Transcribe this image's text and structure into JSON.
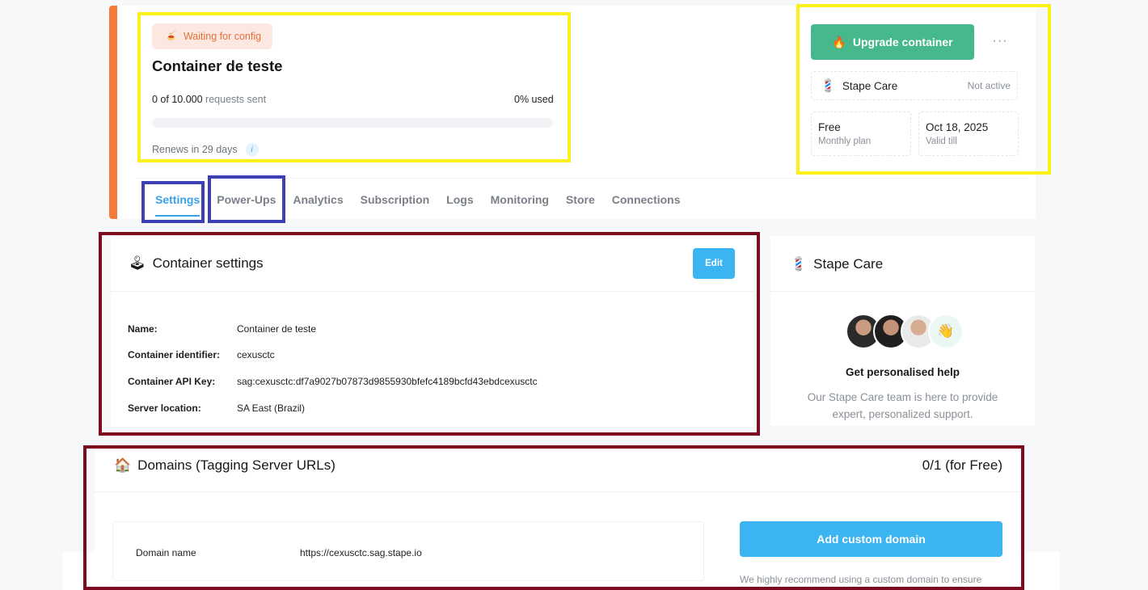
{
  "container": {
    "status": "Waiting for config",
    "status_icon": "🍝",
    "title": "Container de teste",
    "requests_count": "0 of 10.000",
    "requests_label": "requests sent",
    "used": "0% used",
    "progress_percent": 0,
    "renews": "Renews in 29 days",
    "info_icon": "i"
  },
  "header_actions": {
    "upgrade_label": "Upgrade container",
    "upgrade_icon": "🔥",
    "more_label": "···",
    "care_label": "Stape Care",
    "care_icon": "💈",
    "care_status": "Not active",
    "plan_name": "Free",
    "plan_caption": "Monthly plan",
    "valid_date": "Oct 18, 2025",
    "valid_caption": "Valid till"
  },
  "tabs": [
    {
      "label": "Settings",
      "active": true
    },
    {
      "label": "Power-Ups",
      "active": false
    },
    {
      "label": "Analytics",
      "active": false
    },
    {
      "label": "Subscription",
      "active": false
    },
    {
      "label": "Logs",
      "active": false
    },
    {
      "label": "Monitoring",
      "active": false
    },
    {
      "label": "Store",
      "active": false
    },
    {
      "label": "Connections",
      "active": false
    }
  ],
  "settings": {
    "title": "Container settings",
    "title_icon": "🕹",
    "edit_label": "Edit",
    "rows": [
      {
        "key": "Name:",
        "value": "Container de teste"
      },
      {
        "key": "Container identifier:",
        "value": "cexusctc"
      },
      {
        "key": "Container API Key:",
        "value": "sag:cexusctc:df7a9027b07873d9855930bfefc4189bcfd43ebdcexusctc"
      },
      {
        "key": "Server location:",
        "value": "SA East (Brazil)"
      }
    ]
  },
  "stape_care": {
    "title": "Stape Care",
    "title_icon": "💈",
    "wave_icon": "👋",
    "help_title": "Get personalised help",
    "help_text": "Our Stape Care team is here to provide expert, personalized support."
  },
  "domains": {
    "title": "Domains (Tagging Server URLs)",
    "title_icon": "🏠",
    "count": "0/1 (for Free)",
    "domain_key": "Domain name",
    "domain_value": "https://cexusctc.sag.stape.io",
    "add_label": "Add custom domain",
    "recommend": "We highly recommend using a custom domain to ensure"
  },
  "colors": {
    "accent_orange": "#f47b3a",
    "primary_blue": "#3db4f2",
    "upgrade_green": "#46b88b",
    "highlight_yellow": "#fbf119",
    "highlight_blue": "#3c40b3",
    "highlight_maroon": "#7d0a1e"
  }
}
